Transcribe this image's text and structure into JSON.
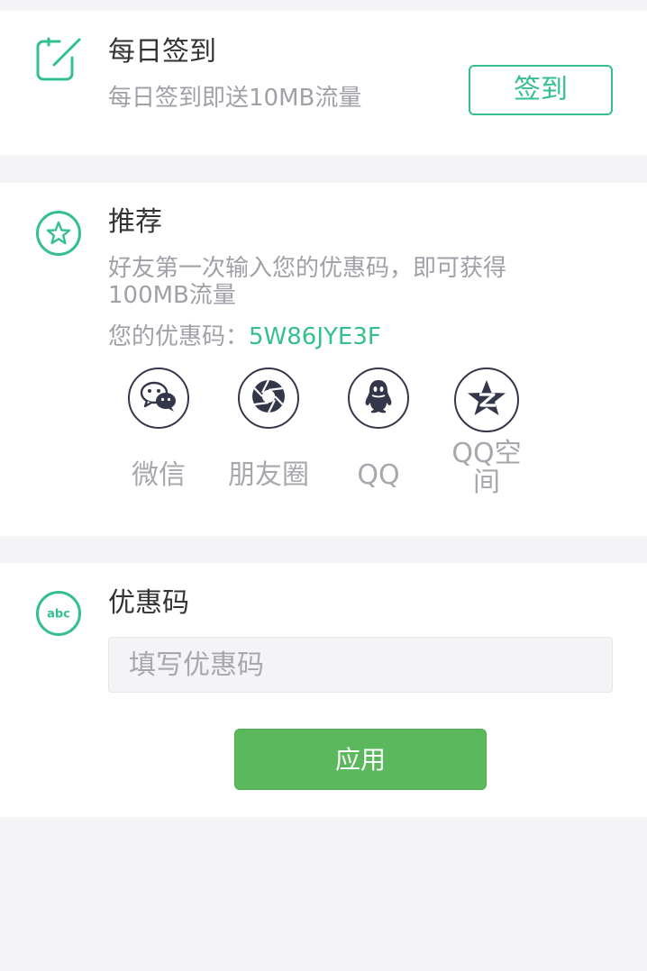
{
  "checkin": {
    "title": "每日签到",
    "subtitle": "每日签到即送10MB流量",
    "button_label": "签到"
  },
  "recommend": {
    "title": "推荐",
    "subtitle": "好友第一次输入您的优惠码，即可获得100MB流量",
    "code_label": "您的优惠码：",
    "code_value": "5W86JYE3F",
    "share_targets": [
      {
        "label": "微信",
        "icon": "wechat-icon"
      },
      {
        "label": "朋友圈",
        "icon": "moments-icon"
      },
      {
        "label": "QQ",
        "icon": "qq-icon"
      },
      {
        "label": "QQ空间",
        "icon": "qzone-icon"
      }
    ]
  },
  "coupon": {
    "title": "优惠码",
    "icon_text": "abc",
    "input_placeholder": "填写优惠码",
    "input_value": "",
    "apply_label": "应用"
  },
  "colors": {
    "accent": "#34c08c",
    "apply_button": "#5cb85c",
    "background": "#f4f4f6",
    "muted_text": "#a0a0a8",
    "icon_stroke": "#34364a"
  }
}
